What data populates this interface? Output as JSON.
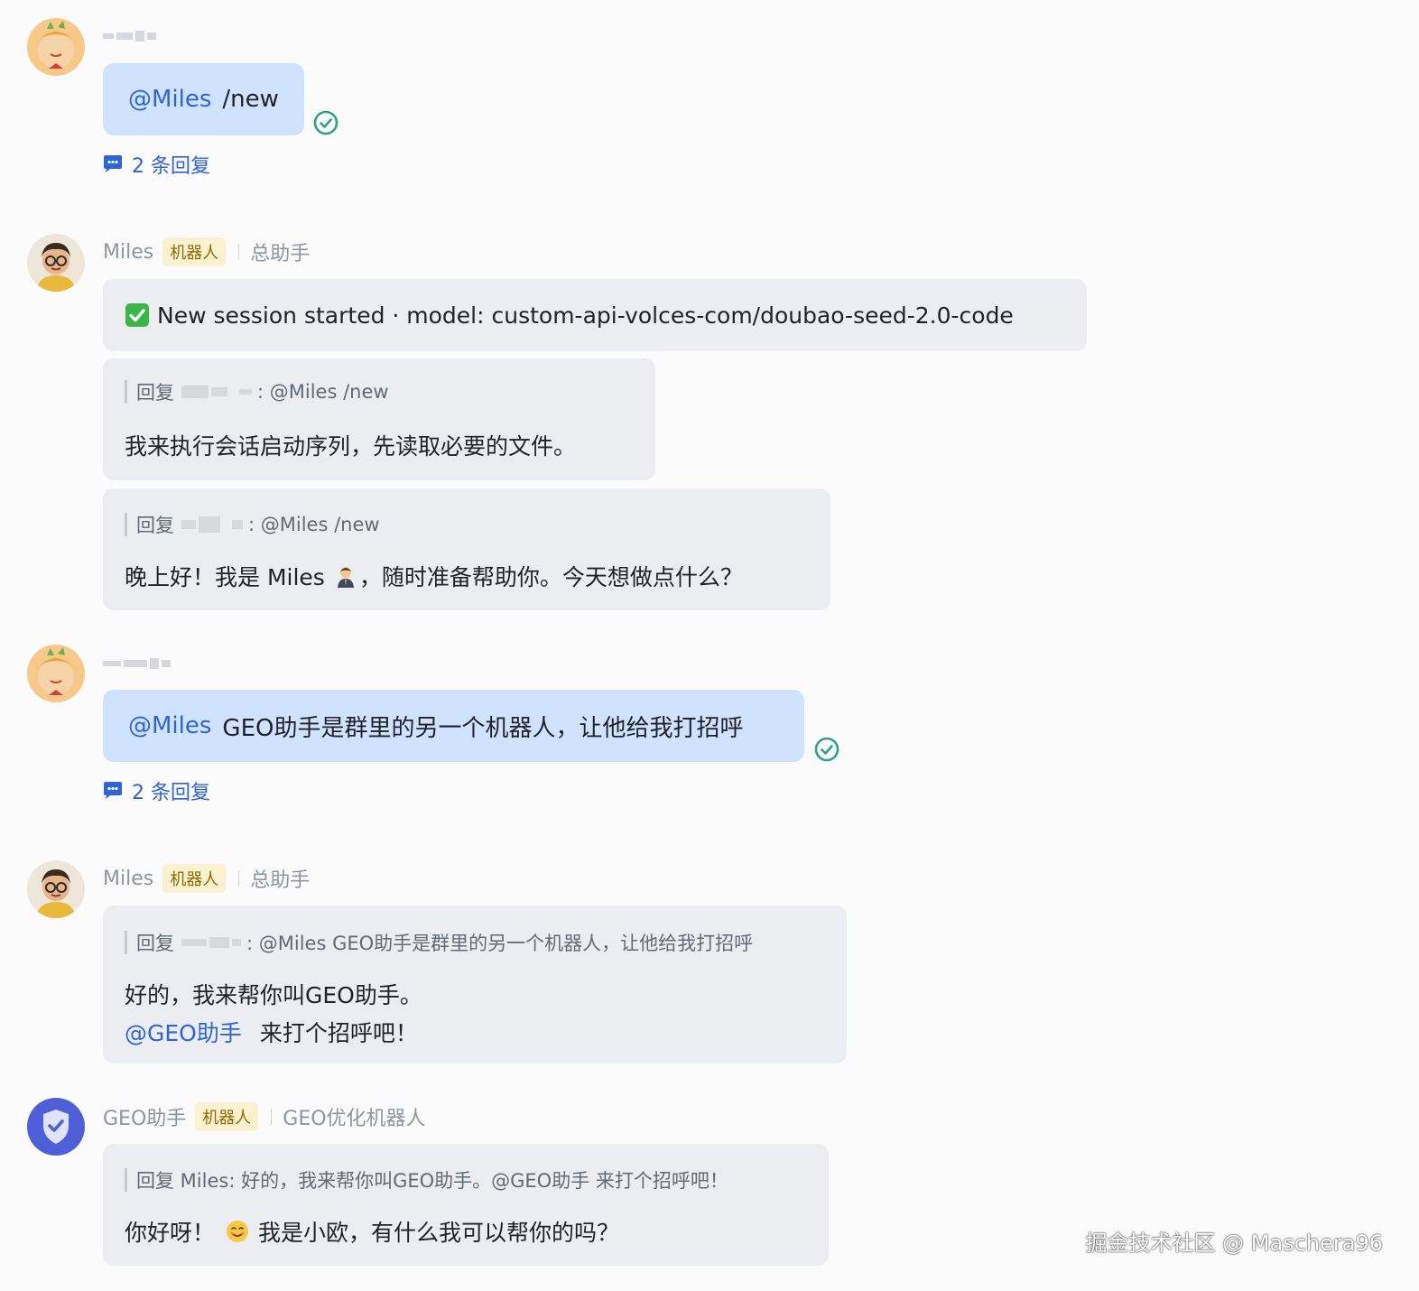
{
  "messages": {
    "m1": {
      "mention": "@Miles",
      "text": "/new",
      "replies": "2 条回复"
    },
    "m2": {
      "sender": "Miles",
      "badge": "机器人",
      "role": "总助手",
      "status_text": "New session started · model: custom-api-volces-com/doubao-seed-2.0-code"
    },
    "m3": {
      "quote_prefix": "回复",
      "quote_suffix": ":  @Miles /new",
      "text": "我来执行会话启动序列，先读取必要的文件。"
    },
    "m4": {
      "quote_prefix": "回复",
      "quote_suffix": ":  @Miles /new",
      "text_a": "晚上好！我是 Miles",
      "text_b": "，随时准备帮助你。今天想做点什么？"
    },
    "m5": {
      "mention": "@Miles",
      "text": "GEO助手是群里的另一个机器人，让他给我打招呼",
      "replies": "2 条回复"
    },
    "m6": {
      "sender": "Miles",
      "badge": "机器人",
      "role": "总助手",
      "quote_prefix": "回复",
      "quote_suffix": ":  @Miles GEO助手是群里的另一个机器人，让他给我打招呼",
      "line1": "好的，我来帮你叫GEO助手。",
      "mention": "@GEO助手",
      "line2": "来打个招呼吧！"
    },
    "m7": {
      "sender": "GEO助手",
      "badge": "机器人",
      "role": "GEO优化机器人",
      "quote": "回复 Miles:  好的，我来帮你叫GEO助手。@GEO助手 来打个招呼吧！",
      "text_a": "你好呀！",
      "text_b": "我是小欧，有什么我可以帮你的吗？"
    }
  },
  "watermark": "掘金技术社区 @ Maschera96",
  "colors": {
    "mention": "#2f64d8",
    "user_bubble": "#cfe2ff",
    "bot_bubble": "#ebedf0",
    "badge_bg": "#faf1d1",
    "check": "#2ea27f"
  }
}
